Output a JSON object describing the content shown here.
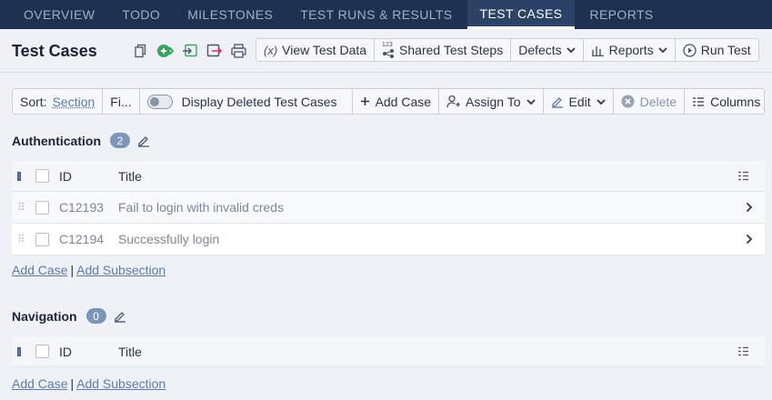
{
  "nav": {
    "tabs": [
      {
        "label": "OVERVIEW"
      },
      {
        "label": "TODO"
      },
      {
        "label": "MILESTONES"
      },
      {
        "label": "TEST RUNS & RESULTS"
      },
      {
        "label": "TEST CASES"
      },
      {
        "label": "REPORTS"
      }
    ],
    "active_index": 4
  },
  "header": {
    "title": "Test Cases",
    "buttons": {
      "view_test_data": "View Test Data",
      "shared_test_steps": "Shared Test Steps",
      "shared_steps_badge": "123",
      "defects": "Defects",
      "reports": "Reports",
      "run_test": "Run Test"
    }
  },
  "toolbar": {
    "sort_label": "Sort:",
    "sort_value": "Section",
    "filter_label": "Fi...",
    "display_deleted": "Display Deleted Test Cases",
    "add_case": "Add Case",
    "assign_to": "Assign To",
    "edit": "Edit",
    "delete": "Delete",
    "columns": "Columns"
  },
  "sections": [
    {
      "name": "Authentication",
      "count": "2",
      "columns": {
        "id": "ID",
        "title": "Title"
      },
      "rows": [
        {
          "id": "C12193",
          "title": "Fail to login with invalid creds"
        },
        {
          "id": "C12194",
          "title": "Successfully login"
        }
      ],
      "add_case": "Add Case",
      "separator": "|",
      "add_subsection": "Add Subsection"
    },
    {
      "name": "Navigation",
      "count": "0",
      "columns": {
        "id": "ID",
        "title": "Title"
      },
      "rows": [],
      "add_case": "Add Case",
      "separator": "|",
      "add_subsection": "Add Subsection"
    }
  ],
  "colors": {
    "nav_bg": "#1f3150",
    "accent": "#5d7aa8",
    "badge": "#7c95b8",
    "green_icon": "#3aa55d",
    "pink_icon": "#d6336c"
  }
}
